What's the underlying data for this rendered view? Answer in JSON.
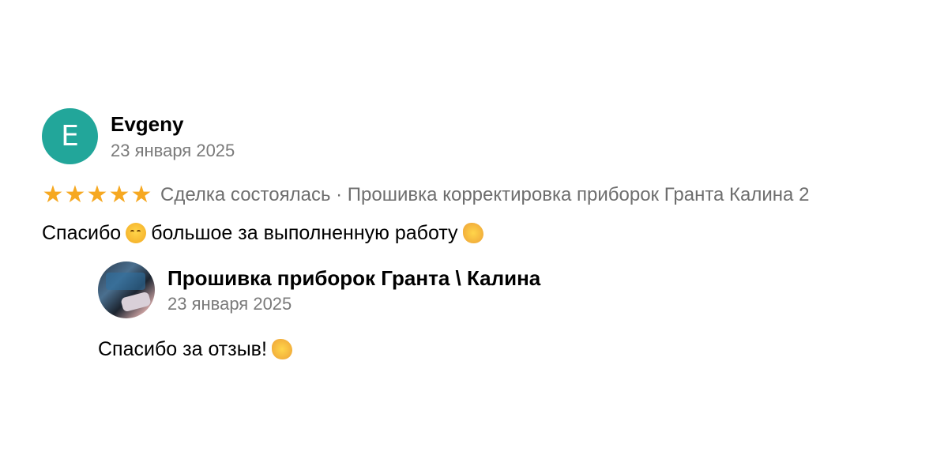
{
  "review": {
    "author": "Evgeny",
    "avatar_letter": "E",
    "avatar_color": "#22a69a",
    "date": "23 января 2025",
    "stars": 5,
    "star_color": "#f6a821",
    "deal_info": "Сделка состоялась · Прошивка корректировка приборок Гранта Калина 2",
    "text_part1": "Спасибо",
    "text_part2": "большое за выполненную работу",
    "emoji1": "smiling-face-icon",
    "emoji2": "handshake-icon"
  },
  "reply": {
    "author": "Прошивка приборок Гранта \\ Калина",
    "date": "23 января 2025",
    "text": "Спасибо за отзыв!",
    "emoji": "handshake-icon"
  }
}
